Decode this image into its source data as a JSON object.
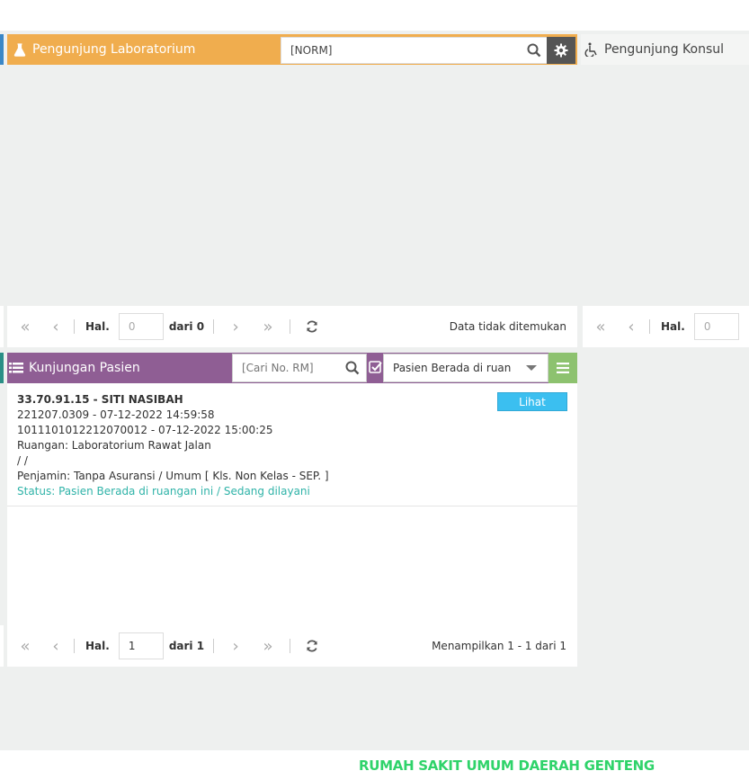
{
  "lab_panel": {
    "title": "Pengunjung Laboratorium",
    "search_value": "[NORM]",
    "pager": {
      "page_label": "Hal.",
      "page_value": "0",
      "of_label": "dari 0",
      "status": "Data tidak ditemukan"
    }
  },
  "konsul_panel": {
    "title": "Pengunjung Konsul",
    "pager": {
      "page_label": "Hal.",
      "page_value": "0"
    }
  },
  "kunjungan_panel": {
    "title": "Kunjungan Pasien",
    "search_placeholder": "[Cari No. RM]",
    "filter_selected": "Pasien Berada di ruan",
    "records": [
      {
        "name": "33.70.91.15 - SITI NASIBAH",
        "line1": "221207.0309 - 07-12-2022 14:59:58",
        "line2": "1011101012212070012 - 07-12-2022 15:00:25",
        "room": "Ruangan: Laboratorium Rawat Jalan",
        "line4": "/ /",
        "payer": "Penjamin: Tanpa Asuransi / Umum [ Kls. Non Kelas - SEP. ]",
        "status": "Status: Pasien Berada di ruangan ini / Sedang dilayani",
        "action_label": "Lihat"
      }
    ],
    "pager": {
      "page_label": "Hal.",
      "page_value": "1",
      "of_label": "dari 1",
      "status": "Menampilkan 1 - 1 dari 1"
    }
  },
  "footer": {
    "brand": "RUMAH SAKIT UMUM DAERAH GENTENG"
  },
  "colors": {
    "lab": "#f0ad4e",
    "kunjungan": "#8f5e94",
    "menu": "#8dc26f",
    "lihat": "#3bbff0",
    "status_text": "#2fb3a8",
    "brand": "#2fd36a"
  }
}
